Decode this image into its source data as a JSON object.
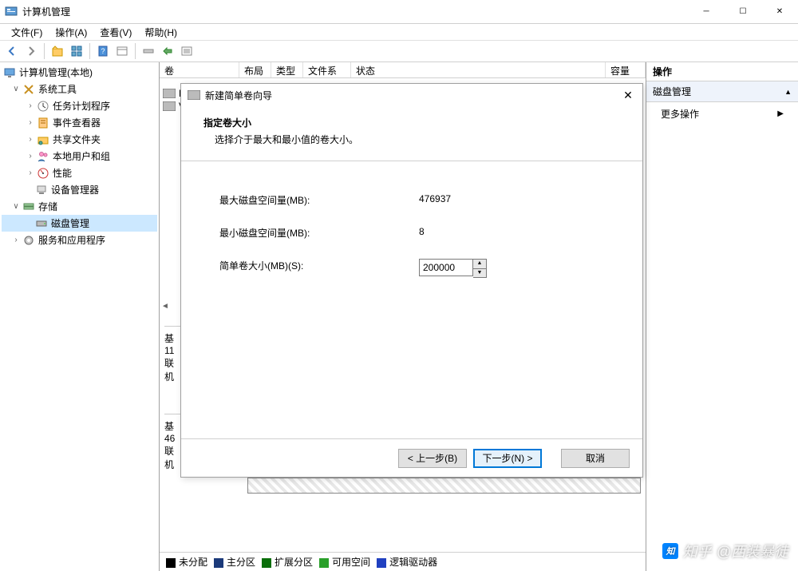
{
  "window": {
    "title": "计算机管理"
  },
  "menu": {
    "file": "文件(F)",
    "action": "操作(A)",
    "view": "查看(V)",
    "help": "帮助(H)"
  },
  "tree": {
    "root": "计算机管理(本地)",
    "system_tools": "系统工具",
    "task_scheduler": "任务计划程序",
    "event_viewer": "事件查看器",
    "shared_folders": "共享文件夹",
    "local_users": "本地用户和组",
    "performance": "性能",
    "device_manager": "设备管理器",
    "storage": "存储",
    "disk_management": "磁盘管理",
    "services_apps": "服务和应用程序"
  },
  "table": {
    "col_volume": "卷",
    "col_layout": "布局",
    "col_type": "类型",
    "col_filesystem": "文件系统",
    "col_status": "状态",
    "col_capacity": "容量"
  },
  "disk_rows": {
    "row1_prefix": "基",
    "row1_line2": "11",
    "row1_line3": "联机",
    "row2_prefix": "基",
    "row2_line2": "46",
    "row2_line3": "联机"
  },
  "legend": {
    "unallocated": "未分配",
    "primary": "主分区",
    "extended": "扩展分区",
    "free": "可用空间",
    "logical": "逻辑驱动器"
  },
  "actions": {
    "header": "操作",
    "section": "磁盘管理",
    "more": "更多操作"
  },
  "wizard": {
    "title": "新建简单卷向导",
    "header_title": "指定卷大小",
    "header_sub": "选择介于最大和最小值的卷大小。",
    "max_label": "最大磁盘空间量(MB):",
    "max_value": "476937",
    "min_label": "最小磁盘空间量(MB):",
    "min_value": "8",
    "size_label": "简单卷大小(MB)(S):",
    "size_value": "200000",
    "back": "< 上一步(B)",
    "next": "下一步(N) >",
    "cancel": "取消"
  },
  "watermark": {
    "site": "知乎",
    "user": "@西装暴徒"
  },
  "colors": {
    "unallocated": "#000000",
    "primary": "#1b3a7a",
    "extended": "#0a6e0a",
    "free": "#2aa02a",
    "logical": "#2040c0"
  }
}
